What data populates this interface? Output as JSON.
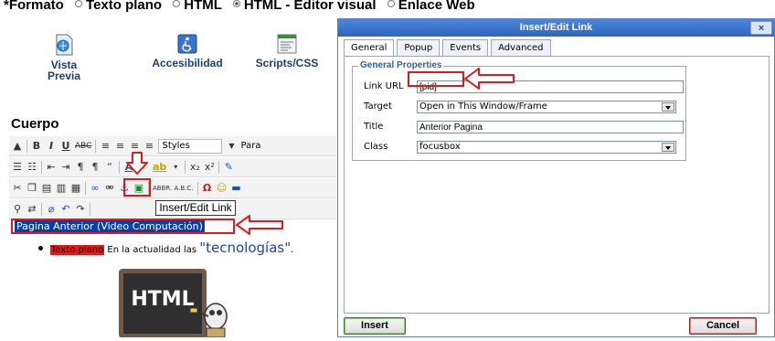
{
  "editor": {
    "format_row": {
      "prefix": "*Formato",
      "options": [
        "Texto plano",
        "HTML",
        "HTML - Editor visual",
        "Enlace Web"
      ],
      "selected": "HTML - Editor visual"
    },
    "icons": [
      {
        "label": "Vista Previa",
        "icon": "preview-icon"
      },
      {
        "label": "Accesibilidad",
        "icon": "accessibility-icon"
      },
      {
        "label": "Scripts/CSS",
        "icon": "scripts-icon"
      }
    ],
    "section_title": "Cuerpo",
    "toolbar_styles": "Styles",
    "toolbar_para": "Para",
    "tooltip": "Insert/Edit Link",
    "selected_text": "Pagina Anterior (Video Computación)",
    "bullet": {
      "label": "Texto plano",
      "text": "En la actualidad las",
      "highlight": "\"tecnologías\"",
      "tail": "."
    },
    "image_text": "HTML"
  },
  "dialog": {
    "title": "Insert/Edit Link",
    "close": "×",
    "tabs": [
      "General",
      "Popup",
      "Events",
      "Advanced"
    ],
    "active_tab": "General",
    "fieldset_legend": "General Properties",
    "fields": {
      "link_url": {
        "label": "Link URL",
        "value": "[pid]"
      },
      "target": {
        "label": "Target",
        "value": "Open in This Window/Frame"
      },
      "title": {
        "label": "Title",
        "value": "Anterior Pagina"
      },
      "class": {
        "label": "Class",
        "value": "focusbox"
      }
    },
    "insert_label": "Insert",
    "cancel_label": "Cancel"
  },
  "colors": {
    "annotation_red": "#e01a1a",
    "dialog_title_blue": "#2d66c0",
    "legend_blue": "#2b5fb3"
  }
}
